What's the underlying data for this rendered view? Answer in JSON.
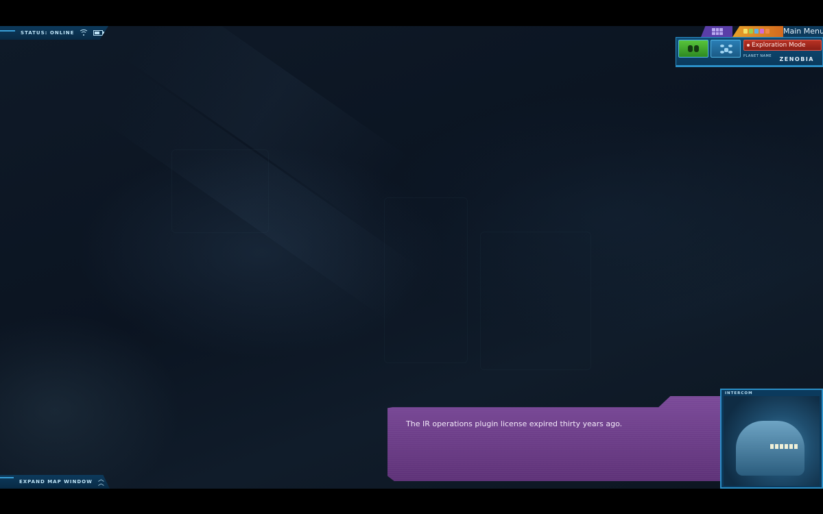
{
  "status": {
    "text": "STATUS: ONLINE",
    "icons": [
      "wifi-icon",
      "battery-icon"
    ]
  },
  "map": {
    "expand_label": "EXPAND MAP WINDOW",
    "icon": "double-chevron-up-icon"
  },
  "top_menu": {
    "main_menu_label": "Main Menu",
    "tab_icons": [
      "grid-icon",
      "colored-dots-icon"
    ]
  },
  "hud": {
    "mode_label": "Exploration Mode",
    "planet_label": "PLANET NAME",
    "planet_name": "ZENOBIA",
    "buttons": [
      "binoculars-icon",
      "drone-icon"
    ]
  },
  "intercom": {
    "label": "INTERCOM"
  },
  "dialogue": {
    "text": "The IR operations plugin license expired thirty years ago."
  },
  "colors": {
    "hud_blue": "#0d3a5c",
    "hud_border": "#2b8fc7",
    "dialogue_purple": "#6d3f8c",
    "mode_red": "#b83224",
    "scan_green": "#58c43b"
  }
}
